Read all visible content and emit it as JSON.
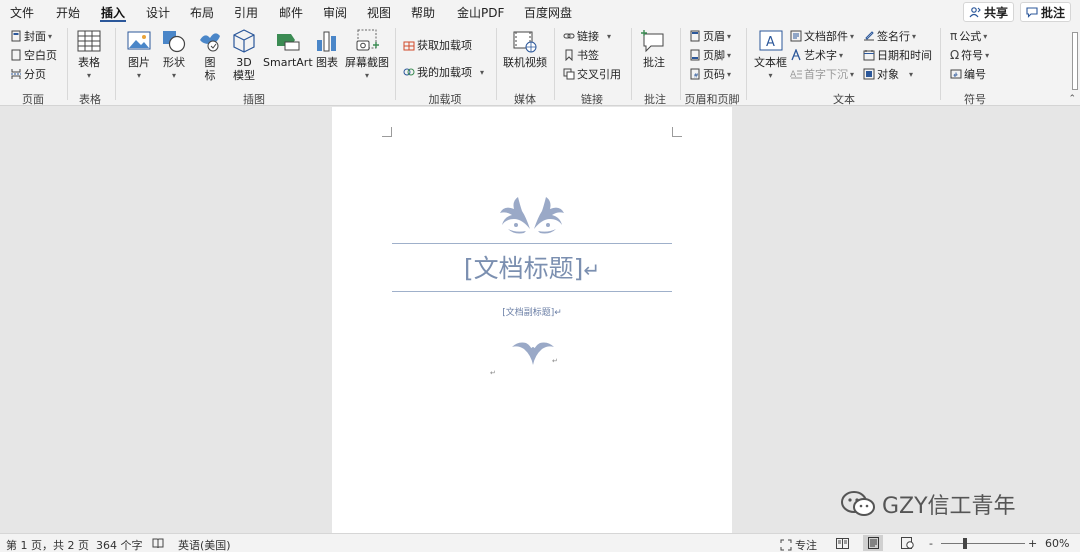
{
  "menu": {
    "items": [
      "文件",
      "开始",
      "插入",
      "设计",
      "布局",
      "引用",
      "邮件",
      "审阅",
      "视图",
      "帮助",
      "金山PDF",
      "百度网盘"
    ],
    "active": "插入",
    "share_label": "共享",
    "comment_label": "批注"
  },
  "ribbon": {
    "pages": {
      "cover": "封面",
      "blank_page": "空白页",
      "page_break": "分页",
      "group": "页面"
    },
    "tables": {
      "table": "表格",
      "group": "表格"
    },
    "illustrations": {
      "picture": "图片",
      "shapes": "形状",
      "icons_line1": "图",
      "icons_line2": "标",
      "model_line1": "3D",
      "model_line2": "模型",
      "smartart": "SmartArt",
      "chart": "图表",
      "screenshot": "屏幕截图",
      "group": "插图"
    },
    "addins": {
      "get_addins": "获取加载项",
      "my_addins": "我的加载项",
      "group": "加载项"
    },
    "media": {
      "online_video": "联机视频",
      "group": "媒体"
    },
    "links": {
      "link": "链接",
      "bookmark": "书签",
      "cross_ref": "交叉引用",
      "group": "链接"
    },
    "comments": {
      "comment": "批注",
      "group": "批注"
    },
    "header_footer": {
      "header": "页眉",
      "footer": "页脚",
      "page_number": "页码",
      "group": "页眉和页脚"
    },
    "text": {
      "text_box": "文本框",
      "quick_parts": "文档部件",
      "wordart": "艺术字",
      "drop_cap": "首字下沉",
      "signature_line": "签名行",
      "date_time": "日期和时间",
      "object": "对象",
      "group": "文本"
    },
    "symbols": {
      "equation": "公式",
      "symbol": "符号",
      "numbering": "编号",
      "group": "符号"
    }
  },
  "document": {
    "title": "[文档标题]",
    "subtitle": "[文档副标题]",
    "title_mark": "↵",
    "subtitle_mark": "↵"
  },
  "status": {
    "page": "第 1 页，共 2 页",
    "words": "364 个字",
    "language": "英语(美国)",
    "focus": "专注",
    "zoom": "60%",
    "zoom_minus": "-",
    "zoom_plus": "+"
  },
  "watermark": {
    "text": "GZY信工青年"
  },
  "colors": {
    "accent": "#2b579a",
    "title": "#7b8fb0",
    "ornament": "#9aa9c7"
  }
}
